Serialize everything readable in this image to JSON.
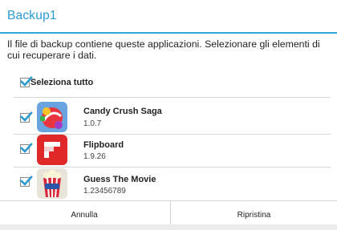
{
  "dialog": {
    "title": "Backup1",
    "message": "Il file di backup contiene queste applicazioni. Selezionare gli elementi di cui recuperare i dati.",
    "select_all": {
      "label": "Seleziona tutto",
      "checked": true
    },
    "apps": [
      {
        "name": "Candy Crush Saga",
        "version": "1.0.7",
        "checked": true,
        "icon": "candy-crush-icon"
      },
      {
        "name": "Flipboard",
        "version": "1.9.26",
        "checked": true,
        "icon": "flipboard-icon"
      },
      {
        "name": "Guess The Movie",
        "version": "1.23456789",
        "checked": true,
        "icon": "guess-the-movie-icon"
      }
    ],
    "buttons": {
      "cancel": "Annulla",
      "restore": "Ripristina"
    }
  },
  "colors": {
    "accent": "#33a7da",
    "check": "#2a9bd0"
  }
}
